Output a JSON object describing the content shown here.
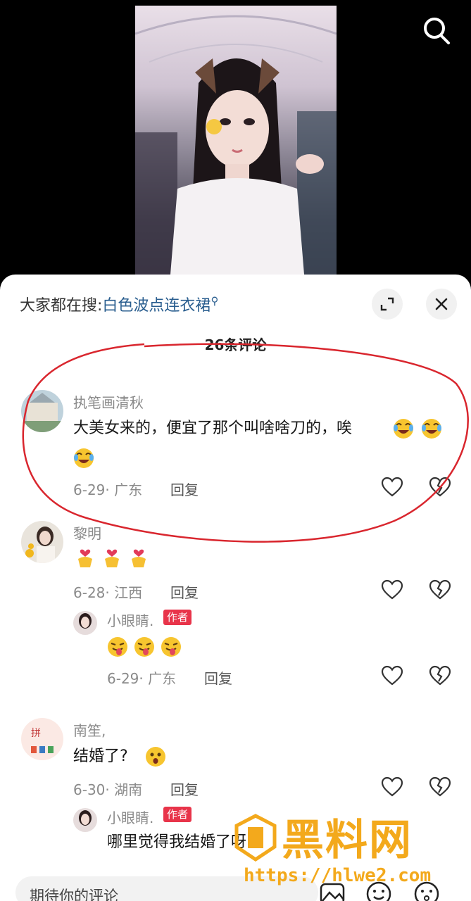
{
  "header": {
    "search_hint_prefix": "大家都在搜:",
    "search_hint_term": "白色波点连衣裙"
  },
  "comments_title": "26条评论",
  "comments": [
    {
      "username": "执笔画清秋",
      "text": "大美女来的，便宜了那个叫啥啥刀的，唉",
      "emojis": [
        "laugh-cry-emoji",
        "laugh-cry-emoji",
        "laugh-cry-emoji"
      ],
      "date_location": "6-29· 广东",
      "reply_label": "回复"
    },
    {
      "username": "黎明",
      "text": "",
      "emojis": [
        "heart-hand-emoji",
        "heart-hand-emoji",
        "heart-hand-emoji"
      ],
      "date_location": "6-28· 江西",
      "reply_label": "回复",
      "replies": [
        {
          "username": "小眼睛.",
          "badge": "作者",
          "emojis": [
            "tongue-out-emoji",
            "tongue-out-emoji",
            "tongue-out-emoji"
          ],
          "date_location": "6-29· 广东",
          "reply_label": "回复"
        }
      ]
    },
    {
      "username": "南笙,",
      "text": "结婚了?",
      "emojis": [
        "surprised-emoji"
      ],
      "date_location": "6-30· 湖南",
      "reply_label": "回复",
      "replies": [
        {
          "username": "小眼睛.",
          "badge": "作者",
          "text": "哪里觉得我结婚了呀"
        }
      ]
    }
  ],
  "input": {
    "placeholder": "期待你的评论"
  },
  "watermark": {
    "title": "黑料网",
    "url": "https://hlwe2.com"
  },
  "colors": {
    "author_badge": "#e8344a",
    "search_term": "#2a5e8f",
    "annotation_red": "#d9262e",
    "watermark": "#f3a91c"
  }
}
